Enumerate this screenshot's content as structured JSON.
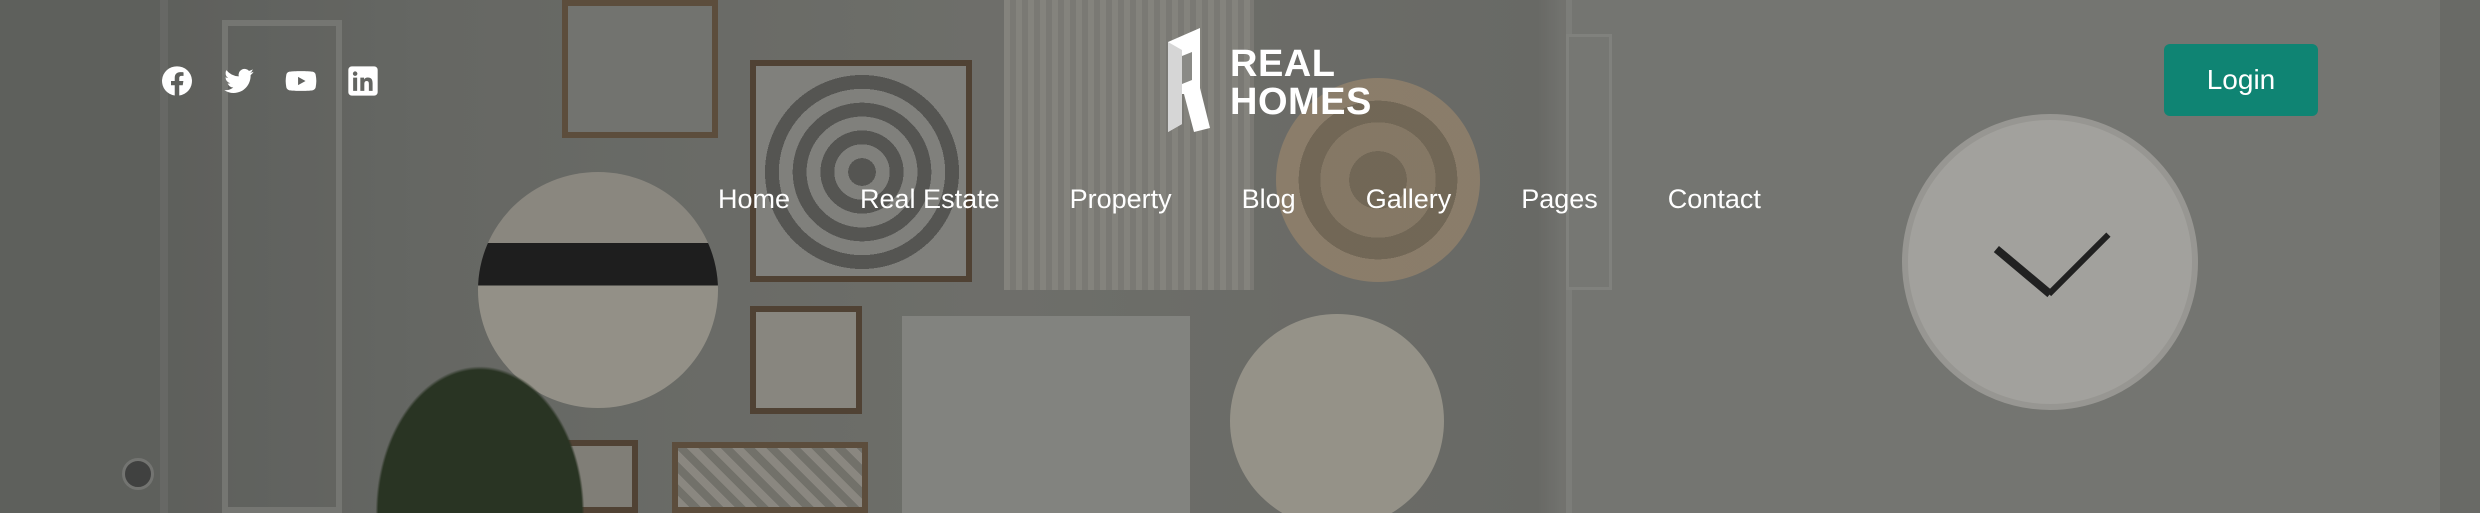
{
  "header": {
    "social": [
      {
        "name": "facebook",
        "icon": "facebook-icon"
      },
      {
        "name": "twitter",
        "icon": "twitter-icon"
      },
      {
        "name": "youtube",
        "icon": "youtube-icon"
      },
      {
        "name": "linkedin",
        "icon": "linkedin-icon"
      }
    ],
    "logo": {
      "line1": "REAL",
      "line2": "HOMES"
    },
    "nav": [
      {
        "label": "Home"
      },
      {
        "label": "Real Estate"
      },
      {
        "label": "Property"
      },
      {
        "label": "Blog"
      },
      {
        "label": "Gallery"
      },
      {
        "label": "Pages"
      },
      {
        "label": "Contact"
      }
    ],
    "login_label": "Login"
  },
  "colors": {
    "accent": "#0f8473",
    "text": "#ffffff"
  }
}
